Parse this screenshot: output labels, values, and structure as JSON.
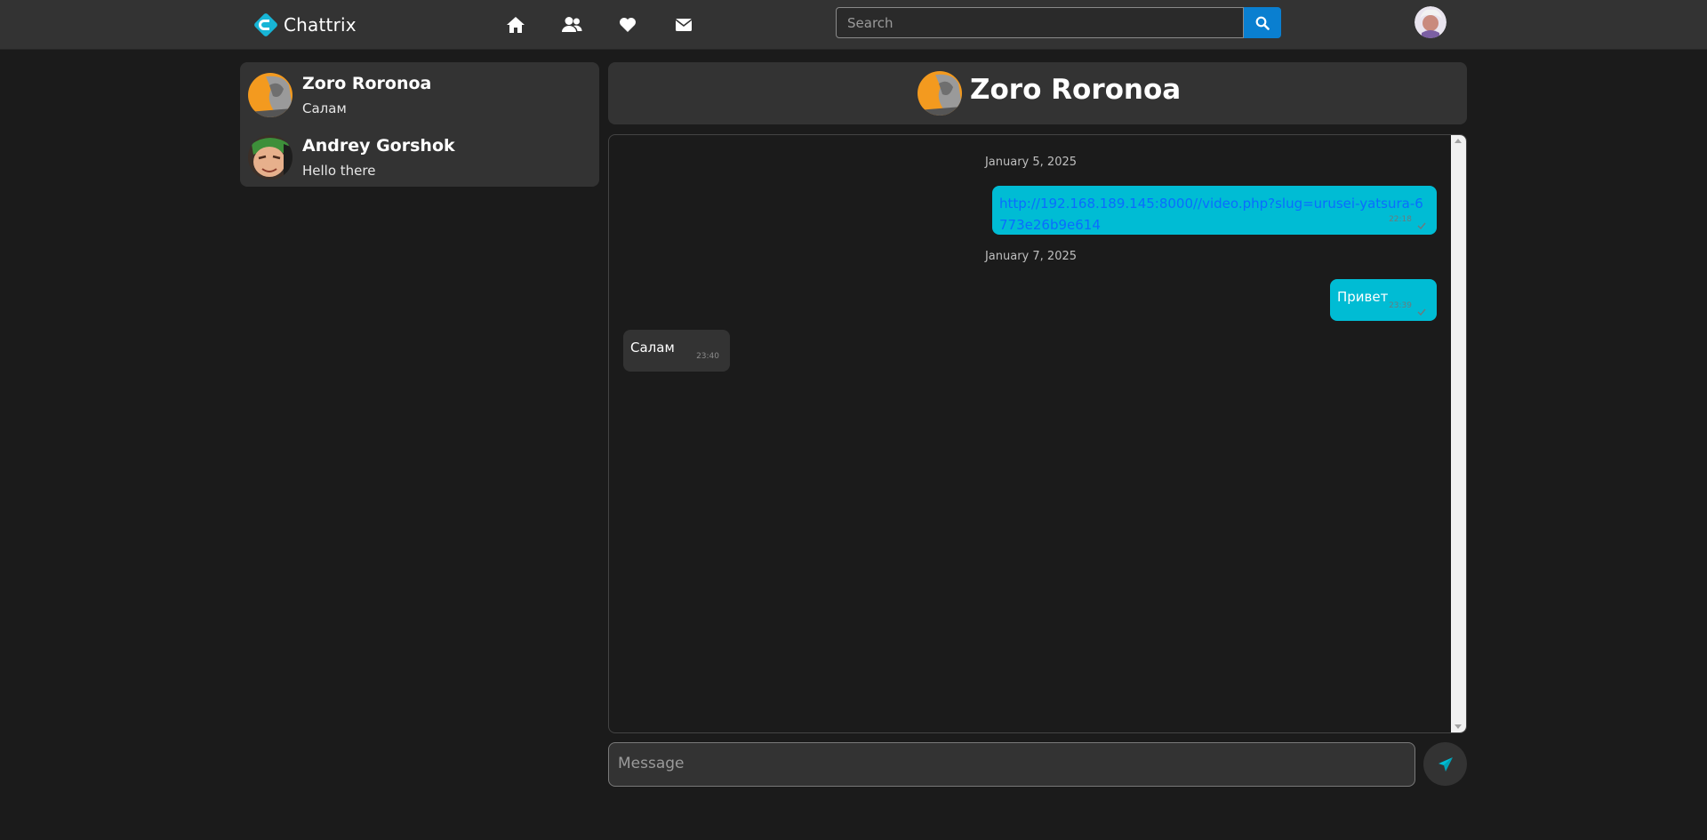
{
  "app": {
    "brand": "Chattrix",
    "accent": "#00bcd4",
    "search_btn_color": "#0a7fd0"
  },
  "nav": {
    "icons": [
      "home-icon",
      "users-icon",
      "heart-icon",
      "envelope-icon"
    ]
  },
  "search": {
    "placeholder": "Search",
    "value": ""
  },
  "conversations": [
    {
      "name": "Zoro Roronoa",
      "last_message": "Салам",
      "avatar": "orange-anime-avatar"
    },
    {
      "name": "Andrey Gorshok",
      "last_message": "Hello there",
      "avatar": "zoro-face-avatar"
    }
  ],
  "chat": {
    "title": "Zoro Roronoa",
    "messages": [
      {
        "type": "date",
        "text": "January 5, 2025"
      },
      {
        "type": "out",
        "text": "http://192.168.189.145:8000//video.php?slug=urusei-yatsura-6773e26b9e614",
        "time": "22:18",
        "is_link": true
      },
      {
        "type": "date",
        "text": "January 7, 2025"
      },
      {
        "type": "out",
        "text": "Привет",
        "time": "23:39"
      },
      {
        "type": "in",
        "text": "Салам",
        "time": "23:40"
      }
    ]
  },
  "composer": {
    "placeholder": "Message",
    "value": ""
  }
}
